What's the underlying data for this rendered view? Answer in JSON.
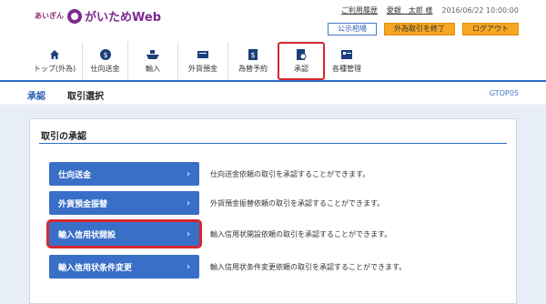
{
  "header": {
    "logo_small": "あいぎん",
    "logo_text": "がいためWeb",
    "history_link": "ご利用履歴",
    "user_name": "愛銀　太郎 様",
    "datetime": "2016/06/22 10:00:00",
    "notice_button": "公示相場",
    "end_button": "外為取引を終了",
    "logout_button": "ログアウト"
  },
  "nav": {
    "items": [
      {
        "label": "トップ(外為)",
        "icon": "home-icon"
      },
      {
        "label": "仕向送金",
        "icon": "remittance-icon"
      },
      {
        "label": "輸入",
        "icon": "import-ship-icon"
      },
      {
        "label": "外貨預金",
        "icon": "deposit-icon"
      },
      {
        "label": "為替予約",
        "icon": "exchange-contract-icon"
      },
      {
        "label": "承認",
        "icon": "approval-icon"
      },
      {
        "label": "各種管理",
        "icon": "management-icon"
      }
    ]
  },
  "titlebar": {
    "crumb_section": "承認",
    "crumb_page": "取引選択",
    "screen_id": "GTOP05"
  },
  "panel": {
    "title": "取引の承認",
    "rows": [
      {
        "label": "仕向送金",
        "desc": "仕向送金依頼の取引を承認することができます。"
      },
      {
        "label": "外貨預金振替",
        "desc": "外貨預金振替依頼の取引を承認することができます。"
      },
      {
        "label": "輸入信用状開設",
        "desc": "輸入信用状開設依頼の取引を承認することができます。"
      },
      {
        "label": "輸入信用状条件変更",
        "desc": "輸入信用状条件変更依頼の取引を承認することができます。"
      }
    ]
  },
  "colors": {
    "accent_blue": "#3a6fc8",
    "highlight_red": "#d7262c",
    "brand_purple": "#7d2a8f",
    "orange_button": "#f6a623"
  }
}
